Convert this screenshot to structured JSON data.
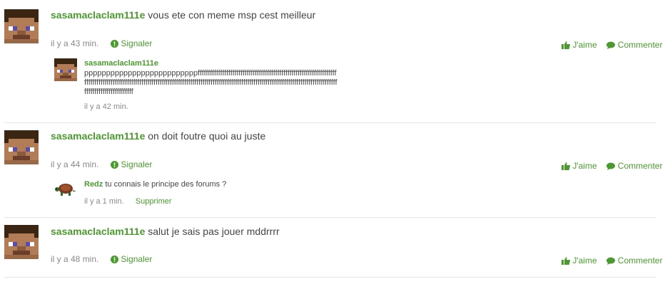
{
  "comments": [
    {
      "author": "sasamaclaclam111e",
      "text": "vous ete con meme msp cest meilleur",
      "time": "il y a 43 min.",
      "report_label": "Signaler",
      "like_label": "J'aime",
      "comment_label": "Commenter",
      "reply": {
        "author": "sasamaclaclam111e",
        "text": "ppppppppppppppppppppppppppffffffffffffffffffffffffffffffffffffffffffffffffffffffffffffffffffffffffffffffffffffffffffffffffffffffffffffffffffffffffffffffffffffffffffffffffffffffffffffffffffffffffffffffffffffffffffffffffffffffffffffffffffffffff",
        "time": "il y a 42 min."
      }
    },
    {
      "author": "sasamaclaclam111e",
      "text": "on doit foutre quoi au juste",
      "time": "il y a 44 min.",
      "report_label": "Signaler",
      "like_label": "J'aime",
      "comment_label": "Commenter",
      "reply": {
        "author": "Redz",
        "text": "tu connais le principe des forums ?",
        "time": "il y a 1 min.",
        "delete_label": "Supprimer"
      }
    },
    {
      "author": "sasamaclaclam111e",
      "text": "salut je sais pas jouer mddrrrr",
      "time": "il y a 48 min.",
      "report_label": "Signaler",
      "like_label": "J'aime",
      "comment_label": "Commenter"
    }
  ],
  "colors": {
    "accent": "#4a9a2e",
    "meta": "#8a8a8a",
    "text": "#444444",
    "divider": "#e4e4e4"
  }
}
